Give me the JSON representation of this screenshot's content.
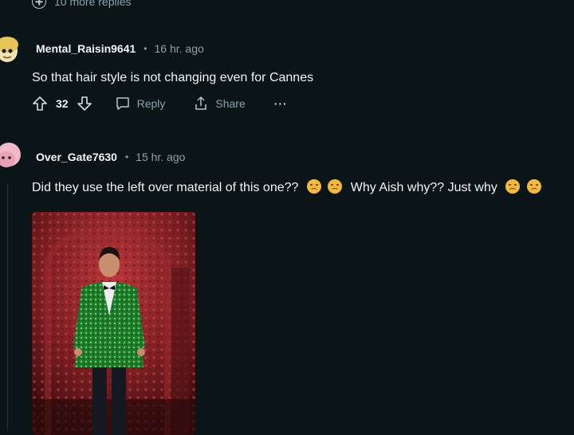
{
  "more_replies": {
    "label": "10 more replies"
  },
  "comments": [
    {
      "username": "Mental_Raisin9641",
      "separator": "•",
      "time": "16 hr. ago",
      "text": "So that hair style is not changing even for Cannes",
      "score": "32",
      "reply_label": "Reply",
      "share_label": "Share",
      "more_label": "···"
    },
    {
      "username": "Over_Gate7630",
      "separator": "•",
      "time": "15 hr. ago",
      "text_part1": "Did they use the left over material of this one??",
      "text_part2": "Why Aish why?? Just why",
      "emoji_name": "worried-face-emoji"
    }
  ]
}
